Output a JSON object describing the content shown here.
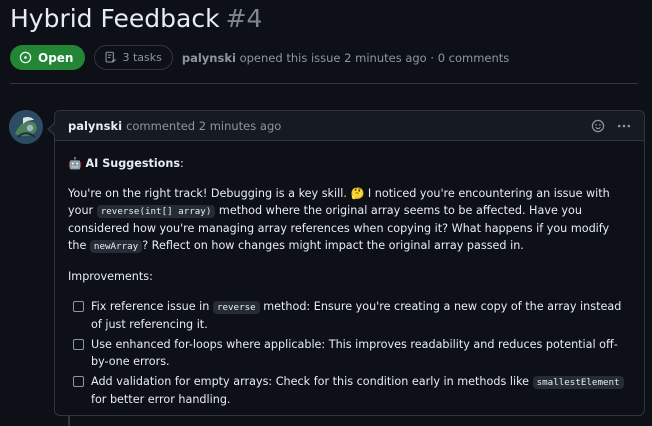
{
  "issue": {
    "title": "Hybrid Feedback",
    "number": "#4",
    "state": "Open",
    "tasks": "3 tasks",
    "author": "palynski",
    "opened_text": "opened this issue 2 minutes ago · 0 comments"
  },
  "comment": {
    "author": "palynski",
    "commented_text": "commented 2 minutes ago",
    "heading_emoji": "🤖",
    "heading": "AI Suggestions",
    "para1": {
      "t1": "You're on the right track! Debugging is a key skill. 🤔 I noticed you're encountering an issue with your ",
      "c1": "reverse(int[] array)",
      "t2": " method where the original array seems to be affected. Have you considered how you're managing array references when copying it? What happens if you modify the ",
      "c2": "newArray",
      "t3": "? Reflect on how changes might impact the original array passed in."
    },
    "improvements_label": "Improvements:",
    "tasks": [
      {
        "t1": "Fix reference issue in ",
        "code": "reverse",
        "t2": " method: Ensure you're creating a new copy of the array instead of just referencing it.",
        "checked": false
      },
      {
        "t1": "Use enhanced for-loops where applicable: This improves readability and reduces potential off-by-one errors.",
        "checked": false
      },
      {
        "t1": "Add validation for empty arrays: Check for this condition early in methods like ",
        "code": "smallestElement",
        "t2": " for better error handling.",
        "checked": false
      }
    ]
  },
  "icons": {
    "state": "issue-opened-icon",
    "tasks": "checklist-icon",
    "reaction": "smiley-icon",
    "menu": "kebab-horizontal-icon",
    "avatar": "user-avatar"
  },
  "colors": {
    "background": "#0d1117",
    "open_badge": "#238636",
    "border": "#30363d",
    "muted_text": "#8d96a0"
  }
}
